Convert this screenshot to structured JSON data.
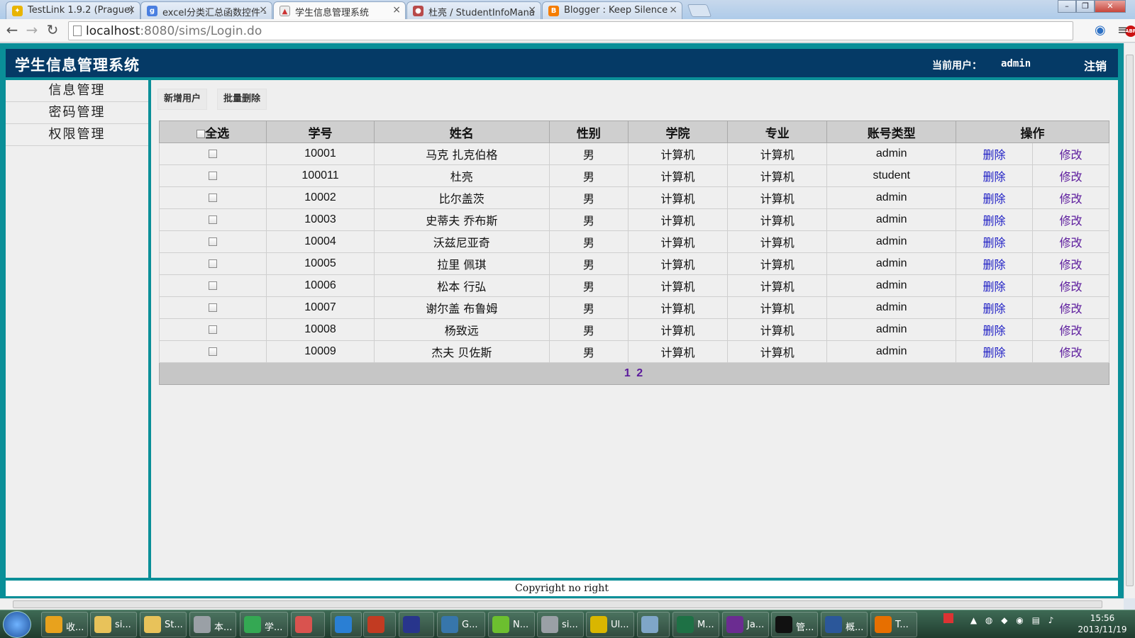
{
  "browser": {
    "tabs": [
      {
        "title": "TestLink 1.9.2 (Prague)",
        "active": false
      },
      {
        "title": "excel分类汇总函数控件 -",
        "active": false
      },
      {
        "title": "学生信息管理系统",
        "active": true
      },
      {
        "title": "杜亮 / StudentInfoMana",
        "active": false
      },
      {
        "title": "Blogger : Keep Silence",
        "active": false
      }
    ],
    "url_host": "localhost",
    "url_rest": ":8080/sims/Login.do"
  },
  "header": {
    "title": "学生信息管理系统",
    "current_user_label": "当前用户：",
    "current_user": "admin",
    "logout_label": "注销"
  },
  "sidebar": {
    "items": [
      {
        "label": "信息管理"
      },
      {
        "label": "密码管理"
      },
      {
        "label": "权限管理"
      }
    ]
  },
  "actions": {
    "add_user_label": "新增用户",
    "batch_delete_label": "批量删除"
  },
  "table": {
    "headers": {
      "select_all": "全选",
      "id": "学号",
      "name": "姓名",
      "gender": "性别",
      "college": "学院",
      "major": "专业",
      "account_type": "账号类型",
      "operations": "操作"
    },
    "rows": [
      {
        "id": "10001",
        "name": "马克 扎克伯格",
        "gender": "男",
        "college": "计算机",
        "major": "计算机",
        "account_type": "admin",
        "delete": "删除",
        "edit": "修改"
      },
      {
        "id": "100011",
        "name": "杜亮",
        "gender": "男",
        "college": "计算机",
        "major": "计算机",
        "account_type": "student",
        "delete": "删除",
        "edit": "修改"
      },
      {
        "id": "10002",
        "name": "比尔盖茨",
        "gender": "男",
        "college": "计算机",
        "major": "计算机",
        "account_type": "admin",
        "delete": "删除",
        "edit": "修改"
      },
      {
        "id": "10003",
        "name": "史蒂夫 乔布斯",
        "gender": "男",
        "college": "计算机",
        "major": "计算机",
        "account_type": "admin",
        "delete": "删除",
        "edit": "修改"
      },
      {
        "id": "10004",
        "name": "沃兹尼亚奇",
        "gender": "男",
        "college": "计算机",
        "major": "计算机",
        "account_type": "admin",
        "delete": "删除",
        "edit": "修改"
      },
      {
        "id": "10005",
        "name": "拉里 佩琪",
        "gender": "男",
        "college": "计算机",
        "major": "计算机",
        "account_type": "admin",
        "delete": "删除",
        "edit": "修改"
      },
      {
        "id": "10006",
        "name": "松本 行弘",
        "gender": "男",
        "college": "计算机",
        "major": "计算机",
        "account_type": "admin",
        "delete": "删除",
        "edit": "修改"
      },
      {
        "id": "10007",
        "name": "谢尔盖 布鲁姆",
        "gender": "男",
        "college": "计算机",
        "major": "计算机",
        "account_type": "admin",
        "delete": "删除",
        "edit": "修改"
      },
      {
        "id": "10008",
        "name": "杨致远",
        "gender": "男",
        "college": "计算机",
        "major": "计算机",
        "account_type": "admin",
        "delete": "删除",
        "edit": "修改"
      },
      {
        "id": "10009",
        "name": "杰夫 贝佐斯",
        "gender": "男",
        "college": "计算机",
        "major": "计算机",
        "account_type": "admin",
        "delete": "删除",
        "edit": "修改"
      }
    ],
    "pages": [
      "1",
      "2"
    ]
  },
  "footer": {
    "text": "Copyright no right"
  },
  "taskbar": {
    "items": [
      {
        "label": "收...",
        "color": "#e8a21d"
      },
      {
        "label": "si...",
        "color": "#e8c25a"
      },
      {
        "label": "St...",
        "color": "#e8c25a"
      },
      {
        "label": "本...",
        "color": "#9aa0a6"
      },
      {
        "label": "学...",
        "color": "#34a853"
      },
      {
        "label": "",
        "color": "#d9534f"
      },
      {
        "label": "",
        "color": "#2a7fd4"
      },
      {
        "label": "",
        "color": "#c23b22"
      },
      {
        "label": "",
        "color": "#28358c"
      },
      {
        "label": "G...",
        "color": "#3776ab"
      },
      {
        "label": "N...",
        "color": "#6cbf2f"
      },
      {
        "label": "si...",
        "color": "#9aa0a6"
      },
      {
        "label": "Ul...",
        "color": "#d9b600"
      },
      {
        "label": "",
        "color": "#7fa6c8"
      },
      {
        "label": "M...",
        "color": "#1e7145"
      },
      {
        "label": "Ja...",
        "color": "#6b2c91"
      },
      {
        "label": "管...",
        "color": "#111111"
      },
      {
        "label": "概...",
        "color": "#2b579a"
      },
      {
        "label": "T...",
        "color": "#e76f00"
      }
    ],
    "clock_time": "15:56",
    "clock_date": "2013/11/19"
  }
}
